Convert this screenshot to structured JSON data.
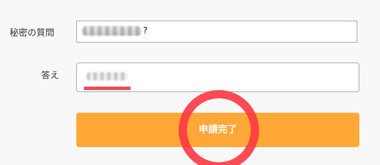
{
  "form": {
    "question_label": "秘密の質問",
    "question_suffix": "?",
    "answer_label": "答え",
    "submit_label": "申請完了"
  }
}
